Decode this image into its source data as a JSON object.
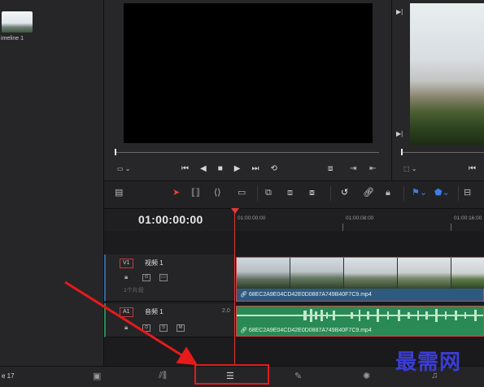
{
  "media_pool": {
    "clip_label": "imeline 1"
  },
  "viewer": {
    "source_transport": [
      "⏮",
      "◀",
      "■",
      "▶",
      "⏭",
      "⟲"
    ],
    "fit_label": "▭ ⌄",
    "timeline_fit_label": "⬚ ⌄"
  },
  "timeline": {
    "timecode": "01:00:00:00",
    "ruler_labels": [
      "01:00:00:00",
      "01:00:08:00",
      "01:00:16:00"
    ],
    "tracks": {
      "video": {
        "id": "V1",
        "name": "视频 1",
        "clip_count": "1个片段"
      },
      "audio": {
        "id": "A1",
        "name": "音频 1",
        "level": "2.0",
        "solo": "S",
        "mute": "M"
      }
    },
    "video_clip_name": "68EC2A9E04CD42E0D0887A749B40F7C9.mp4",
    "audio_clip_name": "68EC2A9E04CD42E0D0887A749B40F7C9.mp4"
  },
  "page_bar": {
    "project_name": "e 17"
  },
  "watermark": "最需网",
  "colors": {
    "playhead": "#e03a35",
    "video_clip": "#2f5a7f",
    "audio_clip": "#2a8a55",
    "highlight": "#e61a1a",
    "annotation_arrow": "#e61a1a",
    "watermark": "#3c3dd4"
  }
}
